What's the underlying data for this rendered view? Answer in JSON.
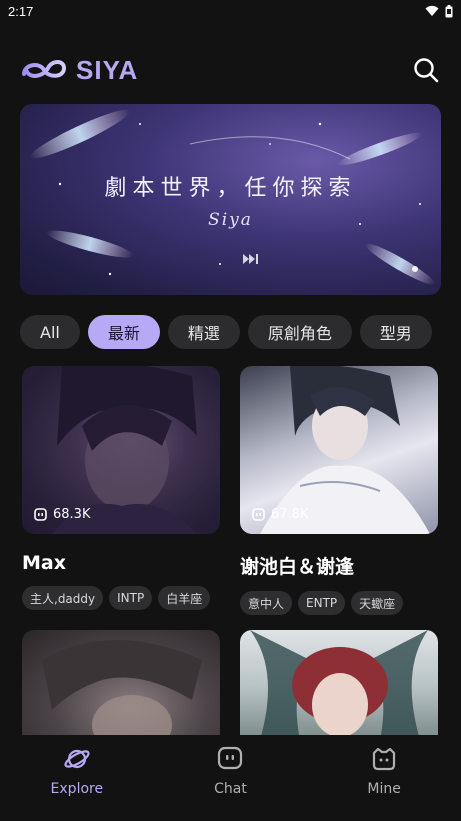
{
  "status": {
    "time": "2:17"
  },
  "header": {
    "brand": "SIYA"
  },
  "banner": {
    "title": "劇本世界，任你探索",
    "subtitle": "Siya"
  },
  "chips": [
    {
      "label": "All",
      "active": false
    },
    {
      "label": "最新",
      "active": true
    },
    {
      "label": "精選",
      "active": false
    },
    {
      "label": "原創角色",
      "active": false
    },
    {
      "label": "型男",
      "active": false
    }
  ],
  "cards": [
    {
      "name": "Max",
      "views": "68.3K",
      "tags": [
        "主人,daddy",
        "INTP",
        "白羊座"
      ]
    },
    {
      "name": "谢池白＆谢逢",
      "views": "67.8K",
      "tags": [
        "意中人",
        "ENTP",
        "天蠍座"
      ]
    }
  ],
  "nav": {
    "explore": "Explore",
    "chat": "Chat",
    "mine": "Mine"
  },
  "colors": {
    "accent": "#b7a9f5",
    "background": "#121212"
  }
}
